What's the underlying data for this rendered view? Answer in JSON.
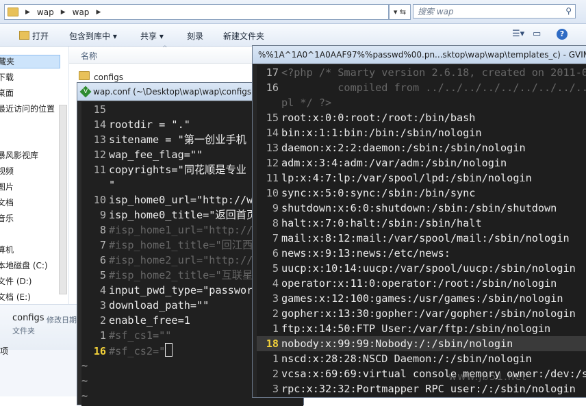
{
  "explorer": {
    "breadcrumb": [
      "wap",
      "wap"
    ],
    "search_placeholder": "搜索 wap",
    "toolbar": {
      "open": "打开",
      "include_in_library": "包含到库中 ▾",
      "share": "共享 ▾",
      "burn": "刻录",
      "new_folder": "新建文件夹"
    },
    "column_name": "名称",
    "nav": [
      "藏夹",
      "下载",
      "桌面",
      "最近访问的位置",
      "暴风影视库",
      "视频",
      "图片",
      "文档",
      "音乐",
      "算机",
      "本地磁盘 (C:)",
      "文件 (D:)",
      "文档 (E:)"
    ],
    "file_row": "configs",
    "details": {
      "name": "configs",
      "meta": "修改日期",
      "type": "文件夹"
    },
    "bottom_cut": "项"
  },
  "vim1": {
    "title": "wap.conf (~\\Desktop\\wap\\wap\\configs",
    "lines": [
      {
        "n": "15",
        "code": ""
      },
      {
        "n": "14",
        "code": "rootdir = \".\""
      },
      {
        "n": "13",
        "code": "sitename = \"第一创业手机"
      },
      {
        "n": "12",
        "code": "wap_fee_flag=\"\""
      },
      {
        "n": "11",
        "code": "copyrights=\"同花顺是专业"
      },
      {
        "n": "",
        "code": "\""
      },
      {
        "n": "10",
        "code": "isp_home0_url=\"http://wa"
      },
      {
        "n": "9",
        "code": "isp_home0_title=\"返回首页"
      },
      {
        "n": "8",
        "code": "#isp_home1_url=\"http://"
      },
      {
        "n": "7",
        "code": "#isp_home1_title=\"回江西"
      },
      {
        "n": "6",
        "code": "#isp_home2_url=\"http://"
      },
      {
        "n": "5",
        "code": "#isp_home2_title=\"互联星"
      },
      {
        "n": "4",
        "code": "input_pwd_type=\"password"
      },
      {
        "n": "3",
        "code": "download_path=\"\""
      },
      {
        "n": "2",
        "code": "enable_free=1"
      },
      {
        "n": "1",
        "code": "#sf_cs1=\"\""
      },
      {
        "n": "16",
        "code": "#sf_cs2=\""
      },
      {
        "n": "",
        "code": "~"
      },
      {
        "n": "",
        "code": "~"
      },
      {
        "n": "",
        "code": "~"
      }
    ]
  },
  "vim2": {
    "title": "%%1A^1A0^1A0AAF97%%passwd%00.pn...sktop\\wap\\wap\\templates_c) - GVIM",
    "lines": [
      {
        "n": "17",
        "code": "<?php /* Smarty version 2.6.18, created on 2011-0"
      },
      {
        "n": "16",
        "code": "         compiled from ../../../../../../../../..."
      },
      {
        "n": "",
        "code": "pl */ ?>"
      },
      {
        "n": "15",
        "code": "root:x:0:0:root:/root:/bin/bash"
      },
      {
        "n": "14",
        "code": "bin:x:1:1:bin:/bin:/sbin/nologin"
      },
      {
        "n": "13",
        "code": "daemon:x:2:2:daemon:/sbin:/sbin/nologin"
      },
      {
        "n": "12",
        "code": "adm:x:3:4:adm:/var/adm:/sbin/nologin"
      },
      {
        "n": "11",
        "code": "lp:x:4:7:lp:/var/spool/lpd:/sbin/nologin"
      },
      {
        "n": "10",
        "code": "sync:x:5:0:sync:/sbin:/bin/sync"
      },
      {
        "n": "9",
        "code": "shutdown:x:6:0:shutdown:/sbin:/sbin/shutdown"
      },
      {
        "n": "8",
        "code": "halt:x:7:0:halt:/sbin:/sbin/halt"
      },
      {
        "n": "7",
        "code": "mail:x:8:12:mail:/var/spool/mail:/sbin/nologin"
      },
      {
        "n": "6",
        "code": "news:x:9:13:news:/etc/news:"
      },
      {
        "n": "5",
        "code": "uucp:x:10:14:uucp:/var/spool/uucp:/sbin/nologin"
      },
      {
        "n": "4",
        "code": "operator:x:11:0:operator:/root:/sbin/nologin"
      },
      {
        "n": "3",
        "code": "games:x:12:100:games:/usr/games:/sbin/nologin"
      },
      {
        "n": "2",
        "code": "gopher:x:13:30:gopher:/var/gopher:/sbin/nologin"
      },
      {
        "n": "1",
        "code": "ftp:x:14:50:FTP User:/var/ftp:/sbin/nologin"
      },
      {
        "n": "18",
        "code": "nobody:x:99:99:Nobody:/:/sbin/nologin"
      },
      {
        "n": "1",
        "code": "nscd:x:28:28:NSCD Daemon:/:/sbin/nologin"
      },
      {
        "n": "2",
        "code": "vcsa:x:69:69:virtual console memory owner:/dev:/s"
      },
      {
        "n": "3",
        "code": "rpc:x:32:32:Portmapper RPC user:/:/sbin/nologin"
      }
    ],
    "watermark": "www.jb51.net"
  }
}
